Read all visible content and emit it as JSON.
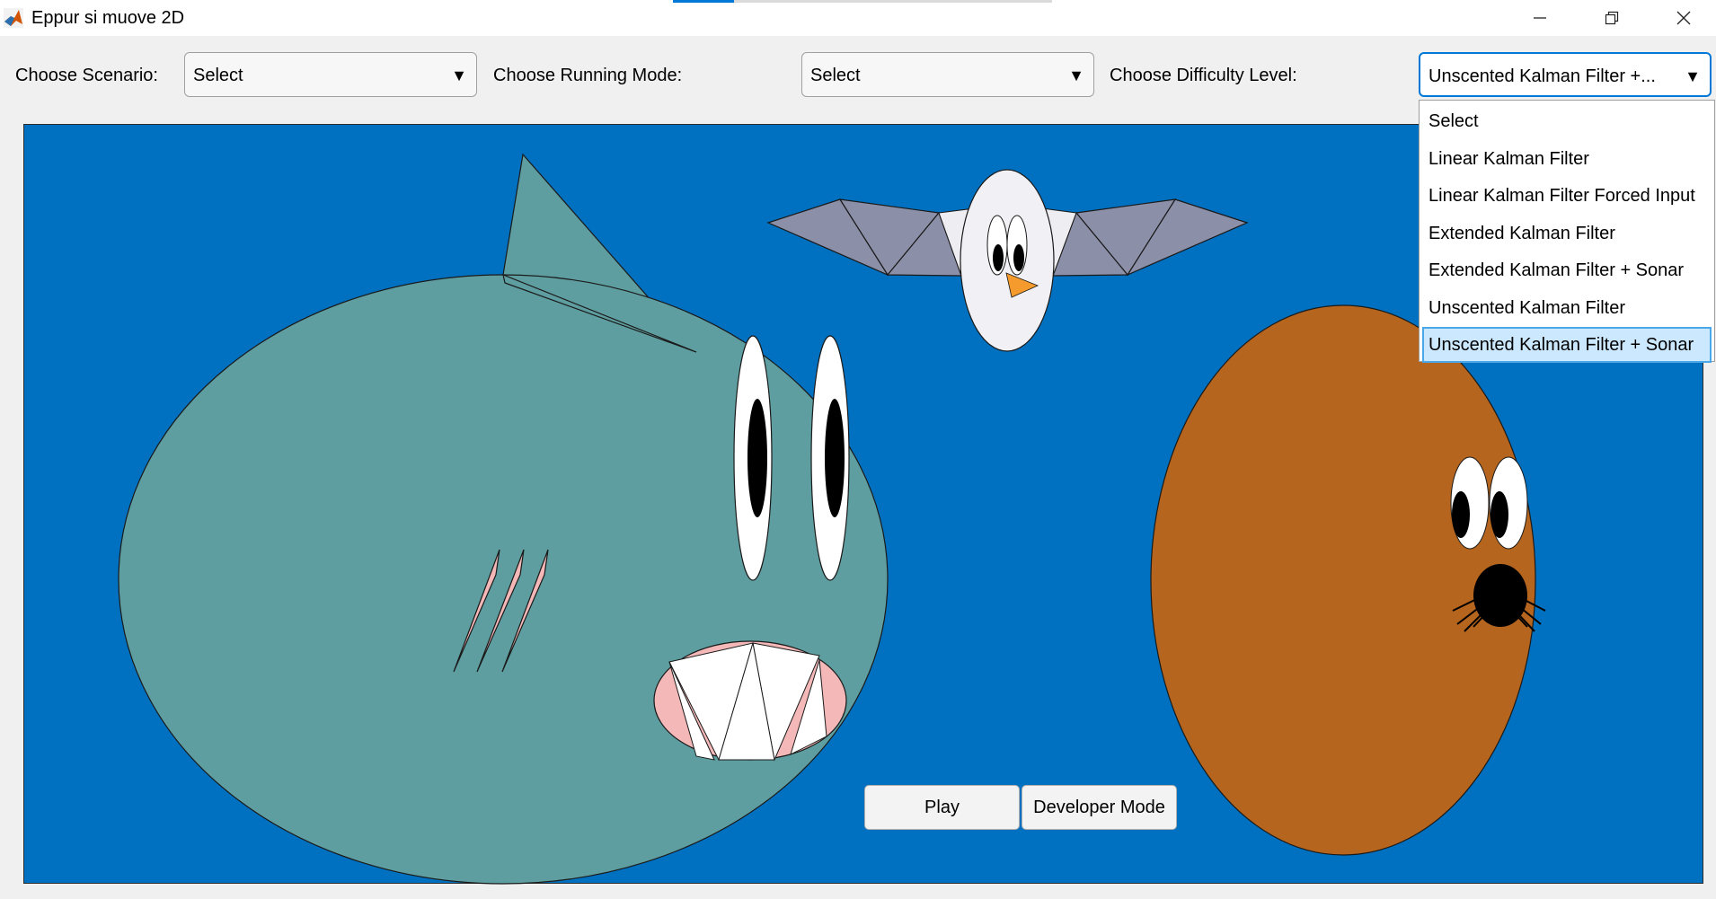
{
  "window": {
    "title": "Eppur si muove 2D",
    "loading_progress": 0.16,
    "controls": [
      "minimize-icon",
      "restore-icon",
      "close-icon"
    ]
  },
  "toolbar": {
    "scenario_label": "Choose Scenario:",
    "scenario_value": "Select",
    "running_mode_label": "Choose Running Mode:",
    "running_mode_value": "Select",
    "difficulty_label": "Choose Difficulty Level:",
    "difficulty_value": "Unscented Kalman Filter +..."
  },
  "difficulty_options": [
    "Select",
    "Linear Kalman Filter",
    "Linear Kalman Filter Forced Input",
    "Extended Kalman Filter",
    "Extended Kalman Filter + Sonar",
    "Unscented Kalman Filter",
    "Unscented Kalman Filter + Sonar"
  ],
  "difficulty_selected_index": 6,
  "buttons": {
    "play": "Play",
    "developer_mode": "Developer Mode"
  },
  "colors": {
    "sea": "#0070c0",
    "shark": "#5f9ea0",
    "seal": "#b5651d",
    "bird_wings": "#8b8fa8",
    "accent": "#0078d7"
  }
}
